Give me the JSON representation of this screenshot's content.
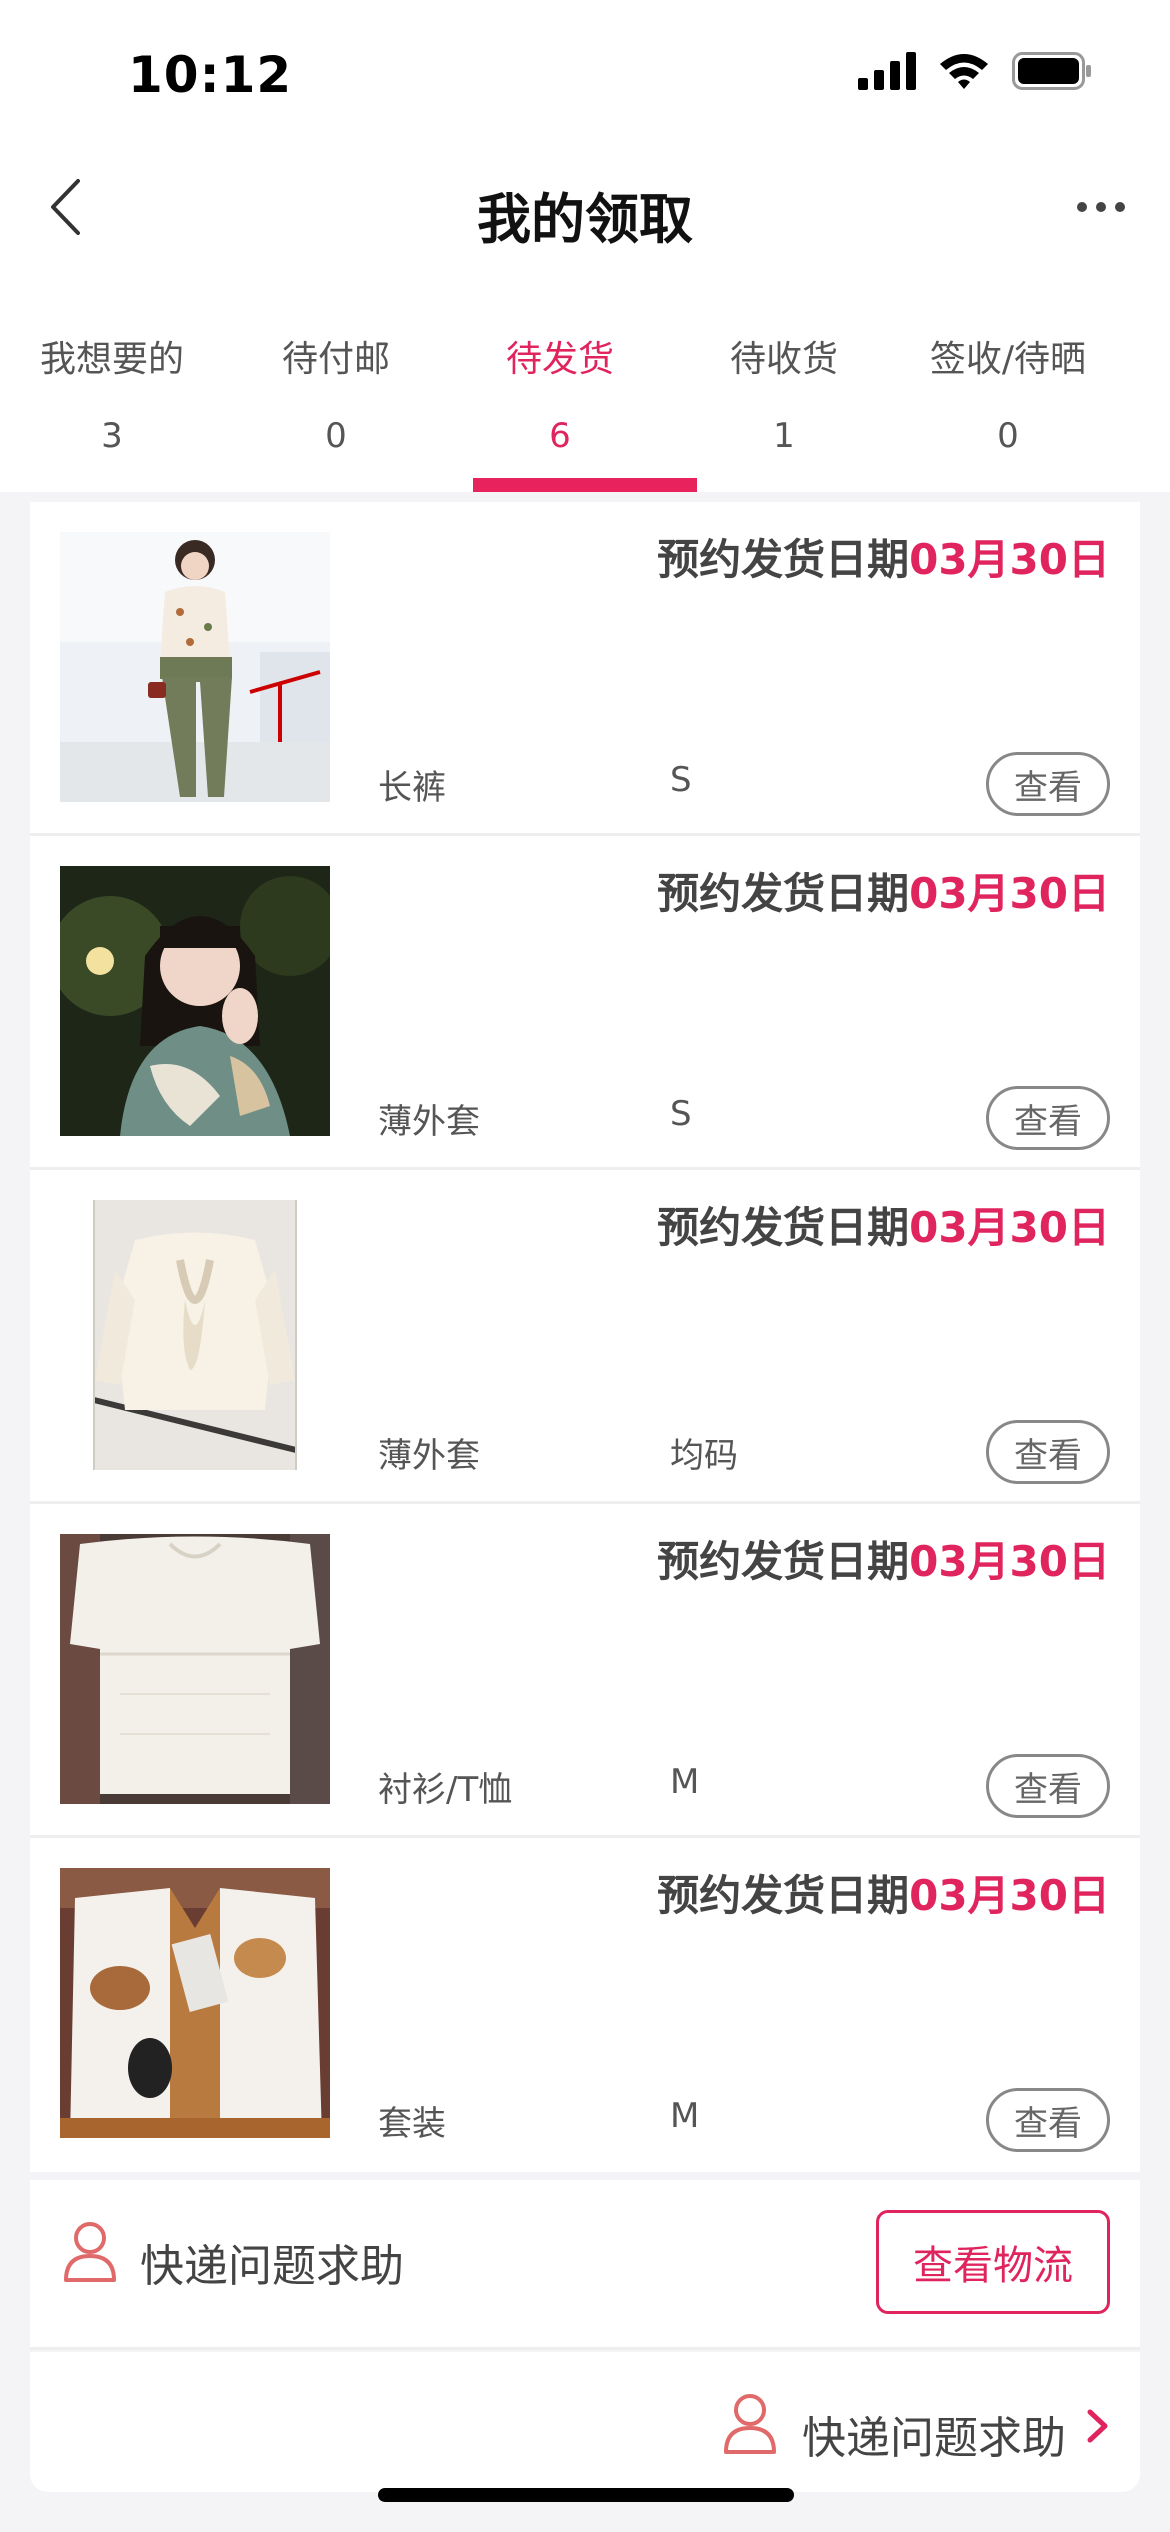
{
  "status_bar": {
    "time": "10:12",
    "signal_icon": "signal-icon",
    "wifi_icon": "wifi-icon",
    "battery_icon": "battery-icon"
  },
  "nav": {
    "title": "我的领取",
    "back_icon": "chevron-left-icon",
    "more_icon": "more-horizontal-icon"
  },
  "tabs": [
    {
      "label": "我想要的",
      "count": "3"
    },
    {
      "label": "待付邮",
      "count": "0"
    },
    {
      "label": "待发货",
      "count": "6",
      "active": true
    },
    {
      "label": "待收货",
      "count": "1"
    },
    {
      "label": "签收/待晒",
      "count": "0"
    }
  ],
  "items": [
    {
      "date_prefix": "预约发货日期",
      "date": "03月30日",
      "category": "长裤",
      "size": "S",
      "view_label": "查看",
      "image": "woman-in-blouse-and-green-pants-photo"
    },
    {
      "date_prefix": "预约发货日期",
      "date": "03月30日",
      "category": "薄外套",
      "size": "S",
      "view_label": "查看",
      "image": "woman-in-floral-jacket-night-photo"
    },
    {
      "date_prefix": "预约发货日期",
      "date": "03月30日",
      "category": "薄外套",
      "size": "均码",
      "view_label": "查看",
      "image": "white-ruffle-blouse-photo"
    },
    {
      "date_prefix": "预约发货日期",
      "date": "03月30日",
      "category": "衬衫/T恤",
      "size": "M",
      "view_label": "查看",
      "image": "white-knit-top-photo"
    },
    {
      "date_prefix": "预约发货日期",
      "date": "03月30日",
      "category": "套装",
      "size": "M",
      "view_label": "查看",
      "image": "fur-vest-photo"
    }
  ],
  "help": {
    "label": "快递问题求助",
    "logistics_button": "查看物流",
    "icon": "person-icon"
  },
  "help_footer": {
    "label": "快递问题求助",
    "icon": "person-icon",
    "arrow_icon": "chevron-right-icon"
  },
  "colors": {
    "accent": "#e0245e",
    "background": "#f4f4f6"
  }
}
